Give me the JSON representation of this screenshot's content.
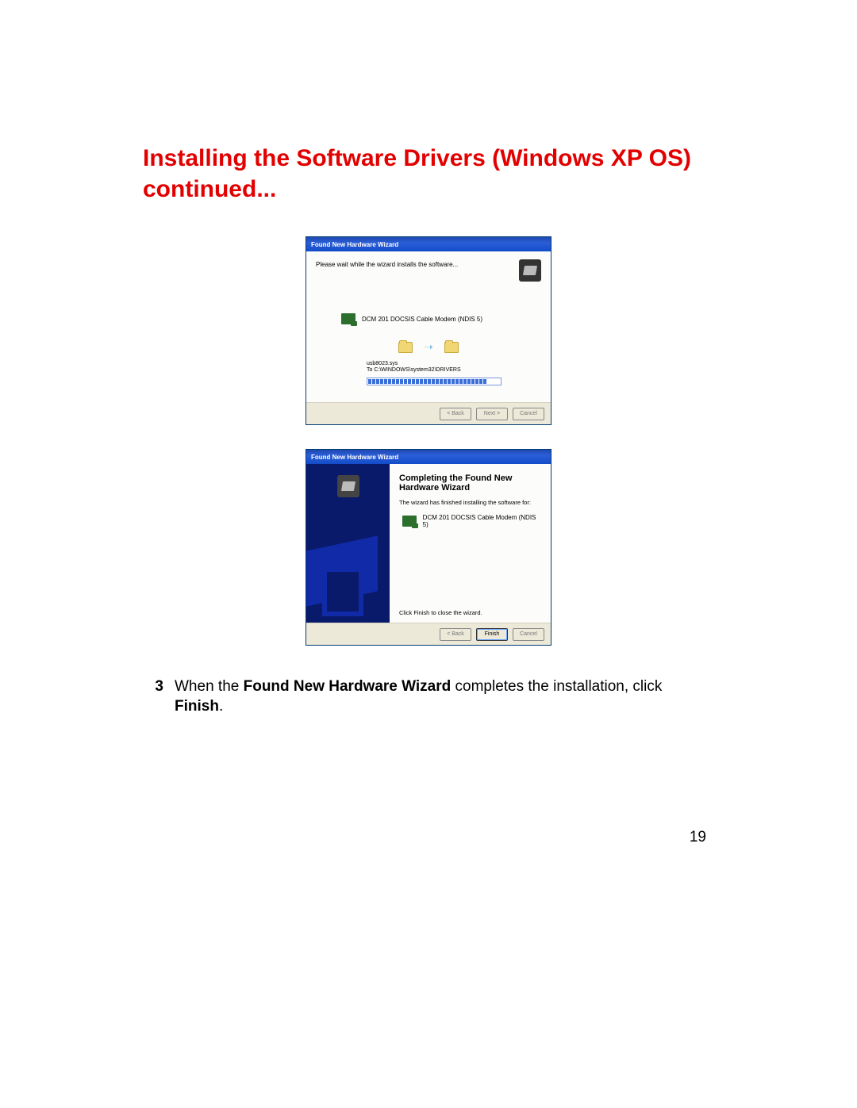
{
  "heading": "Installing the Software Drivers (Windows XP OS) continued...",
  "wizard1": {
    "title": "Found New Hardware Wizard",
    "instruction": "Please wait while the wizard installs the software...",
    "device": "DCM 201 DOCSIS Cable Modem (NDIS 5)",
    "file_line1": "usb8023.sys",
    "file_line2": "To C:\\WINDOWS\\system32\\DRIVERS",
    "back": "< Back",
    "next": "Next >",
    "cancel": "Cancel"
  },
  "wizard2": {
    "title": "Found New Hardware Wizard",
    "complete_title": "Completing the Found New Hardware Wizard",
    "complete_sub": "The wizard has finished installing the software for:",
    "device": "DCM 201 DOCSIS Cable Modem (NDIS 5)",
    "close_hint": "Click Finish to close the wizard.",
    "back": "< Back",
    "finish": "Finish",
    "cancel": "Cancel"
  },
  "step": {
    "num": "3",
    "pre": "When the ",
    "b1": "Found New Hardware Wizard",
    "mid": " completes the installation, click ",
    "b2": "Finish",
    "post": "."
  },
  "page_number": "19"
}
